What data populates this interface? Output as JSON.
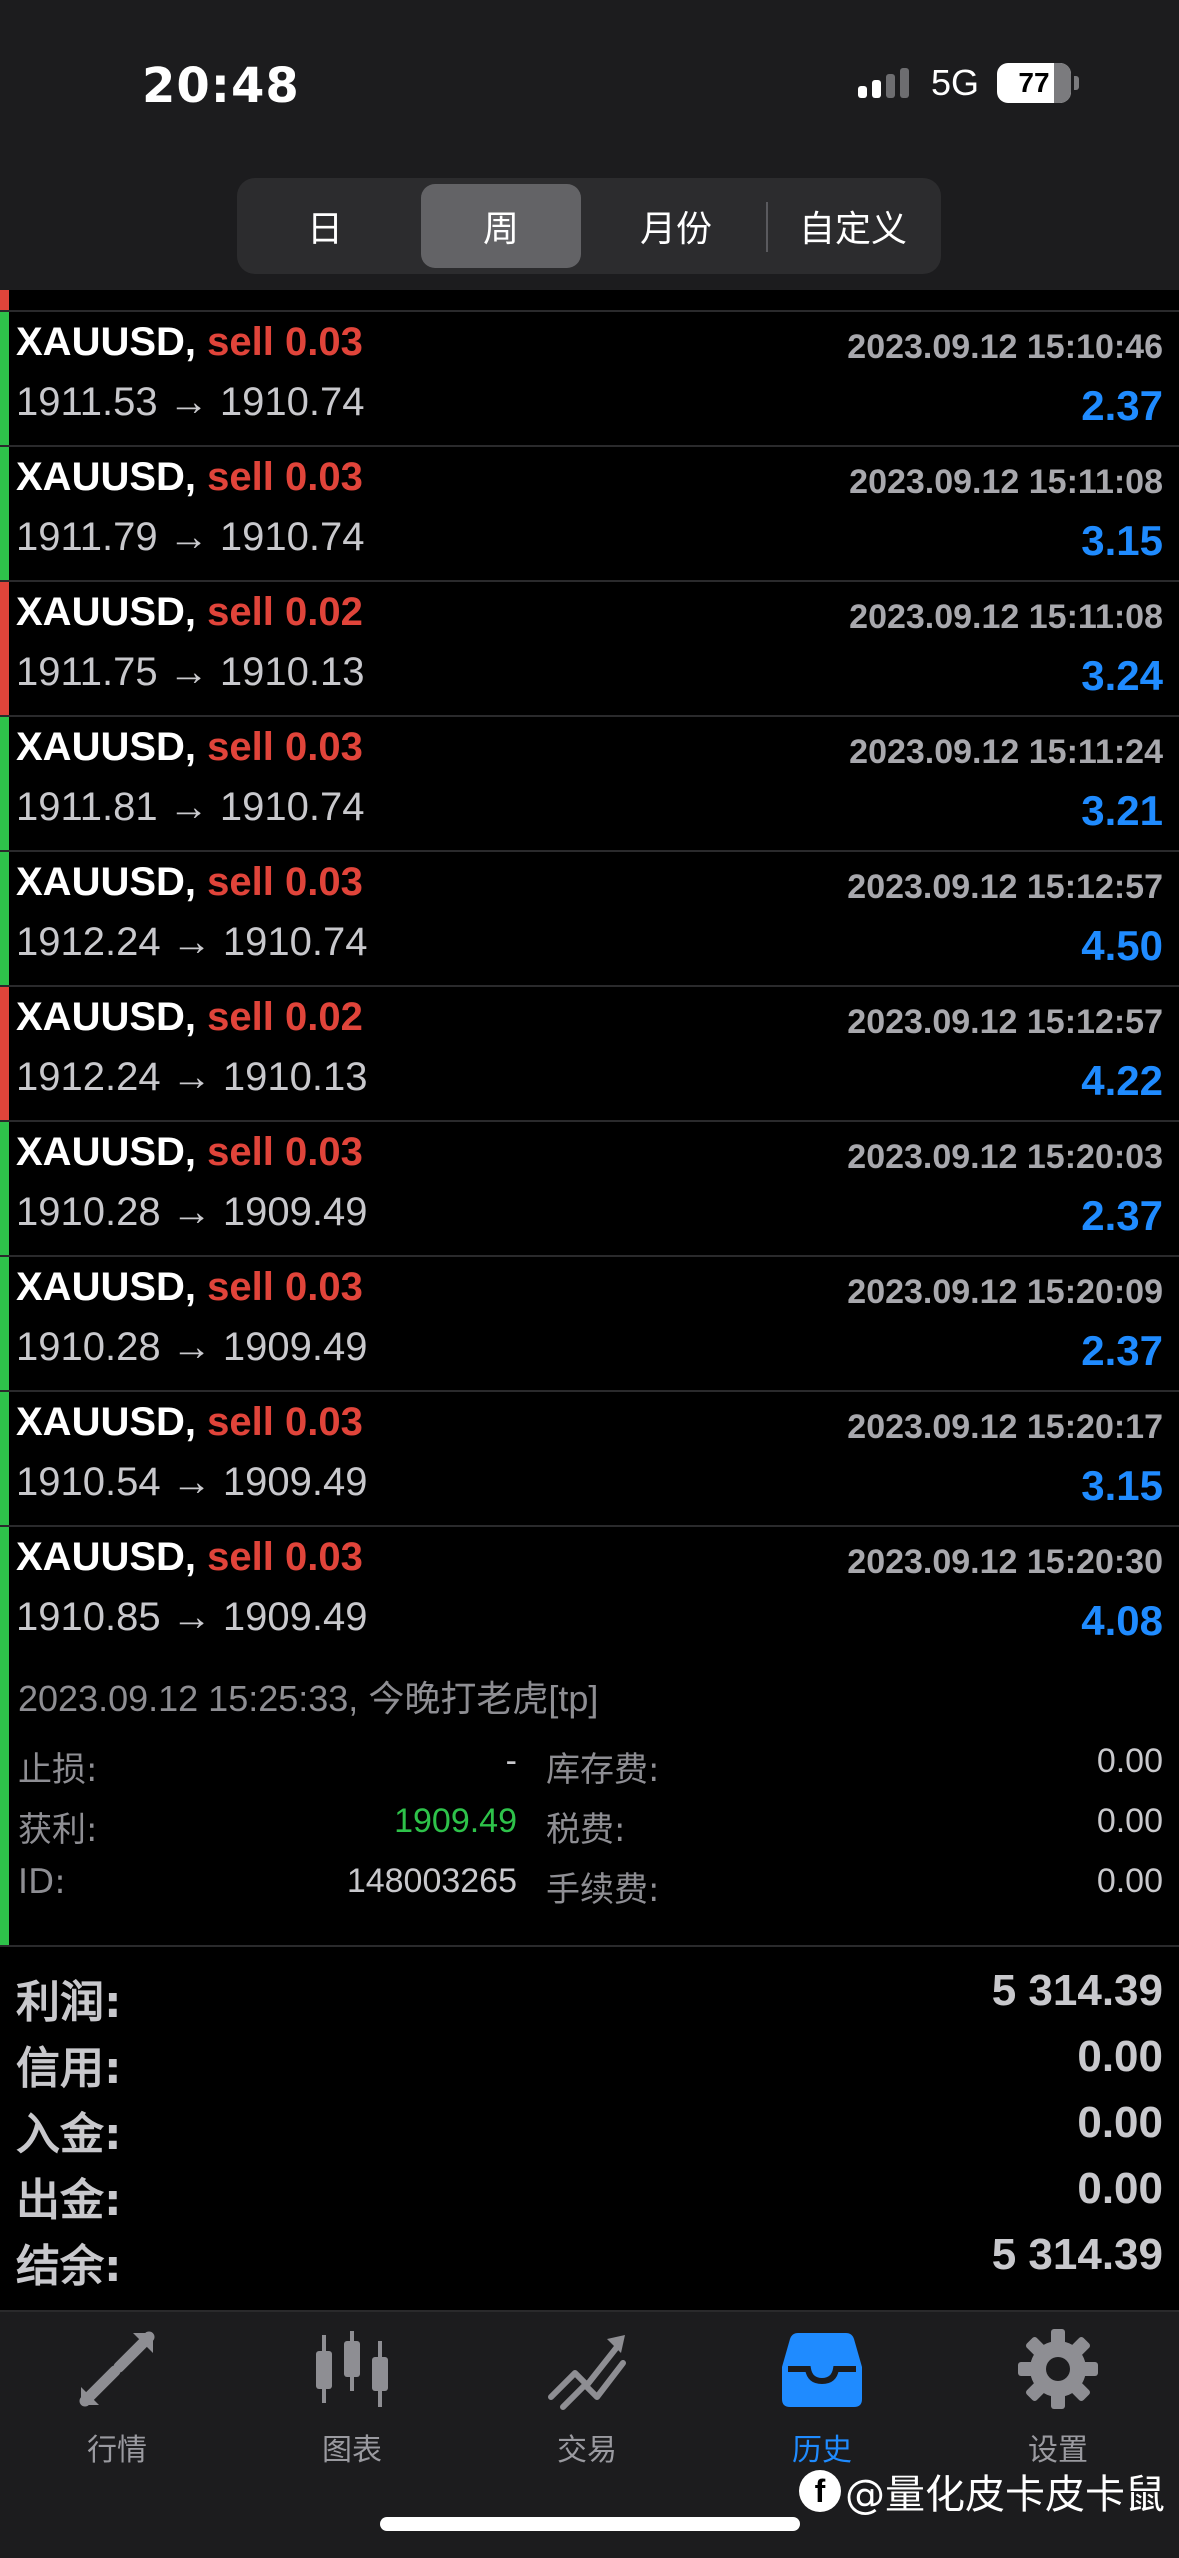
{
  "status": {
    "time": "20:48",
    "network": "5G",
    "battery": "77",
    "battery_level_pct": 77
  },
  "periods": {
    "day": "日",
    "week": "周",
    "month": "月份",
    "custom": "自定义",
    "active": "week"
  },
  "deals": [
    {
      "symbol": "XAUUSD,",
      "side": "sell",
      "volume": "0.03",
      "open": "1911.53",
      "arrow": "→",
      "close": "1910.74",
      "datetime": "2023.09.12 15:10:46",
      "profit": "2.37",
      "accent": "#2ec24a"
    },
    {
      "symbol": "XAUUSD,",
      "side": "sell",
      "volume": "0.03",
      "open": "1911.79",
      "arrow": "→",
      "close": "1910.74",
      "datetime": "2023.09.12 15:11:08",
      "profit": "3.15",
      "accent": "#2ec24a"
    },
    {
      "symbol": "XAUUSD,",
      "side": "sell",
      "volume": "0.02",
      "open": "1911.75",
      "arrow": "→",
      "close": "1910.13",
      "datetime": "2023.09.12 15:11:08",
      "profit": "3.24",
      "accent": "#e0443a"
    },
    {
      "symbol": "XAUUSD,",
      "side": "sell",
      "volume": "0.03",
      "open": "1911.81",
      "arrow": "→",
      "close": "1910.74",
      "datetime": "2023.09.12 15:11:24",
      "profit": "3.21",
      "accent": "#2ec24a"
    },
    {
      "symbol": "XAUUSD,",
      "side": "sell",
      "volume": "0.03",
      "open": "1912.24",
      "arrow": "→",
      "close": "1910.74",
      "datetime": "2023.09.12 15:12:57",
      "profit": "4.50",
      "accent": "#2ec24a"
    },
    {
      "symbol": "XAUUSD,",
      "side": "sell",
      "volume": "0.02",
      "open": "1912.24",
      "arrow": "→",
      "close": "1910.13",
      "datetime": "2023.09.12 15:12:57",
      "profit": "4.22",
      "accent": "#e0443a"
    },
    {
      "symbol": "XAUUSD,",
      "side": "sell",
      "volume": "0.03",
      "open": "1910.28",
      "arrow": "→",
      "close": "1909.49",
      "datetime": "2023.09.12 15:20:03",
      "profit": "2.37",
      "accent": "#2ec24a"
    },
    {
      "symbol": "XAUUSD,",
      "side": "sell",
      "volume": "0.03",
      "open": "1910.28",
      "arrow": "→",
      "close": "1909.49",
      "datetime": "2023.09.12 15:20:09",
      "profit": "2.37",
      "accent": "#2ec24a"
    },
    {
      "symbol": "XAUUSD,",
      "side": "sell",
      "volume": "0.03",
      "open": "1910.54",
      "arrow": "→",
      "close": "1909.49",
      "datetime": "2023.09.12 15:20:17",
      "profit": "3.15",
      "accent": "#2ec24a"
    },
    {
      "symbol": "XAUUSD,",
      "side": "sell",
      "volume": "0.03",
      "open": "1910.85",
      "arrow": "→",
      "close": "1909.49",
      "datetime": "2023.09.12 15:20:30",
      "profit": "4.08",
      "accent": "#2ec24a"
    }
  ],
  "detail": {
    "header": "2023.09.12 15:25:33, 今晚打老虎[tp]",
    "stop_loss_label": "止损:",
    "stop_loss": "-",
    "take_profit_label": "获利:",
    "take_profit": "1909.49",
    "id_label": "ID:",
    "id": "148003265",
    "swap_label": "库存费:",
    "swap": "0.00",
    "tax_label": "税费:",
    "tax": "0.00",
    "fee_label": "手续费:",
    "fee": "0.00"
  },
  "summary": [
    {
      "label": "利润:",
      "value": "5 314.39"
    },
    {
      "label": "信用:",
      "value": "0.00"
    },
    {
      "label": "入金:",
      "value": "0.00"
    },
    {
      "label": "出金:",
      "value": "0.00"
    },
    {
      "label": "结余:",
      "value": "5 314.39"
    }
  ],
  "tabs": [
    {
      "label": "行情",
      "icon": "quotes-arrows-icon"
    },
    {
      "label": "图表",
      "icon": "candlestick-chart-icon"
    },
    {
      "label": "交易",
      "icon": "trade-trend-icon"
    },
    {
      "label": "历史",
      "icon": "history-inbox-icon",
      "active": true
    },
    {
      "label": "设置",
      "icon": "gear-icon"
    }
  ],
  "watermark": {
    "logo": "f",
    "text": "@量化皮卡皮卡鼠"
  },
  "colors": {
    "sell": "#e0443a",
    "profit": "#1f8bff",
    "tp": "#2ec24a"
  }
}
